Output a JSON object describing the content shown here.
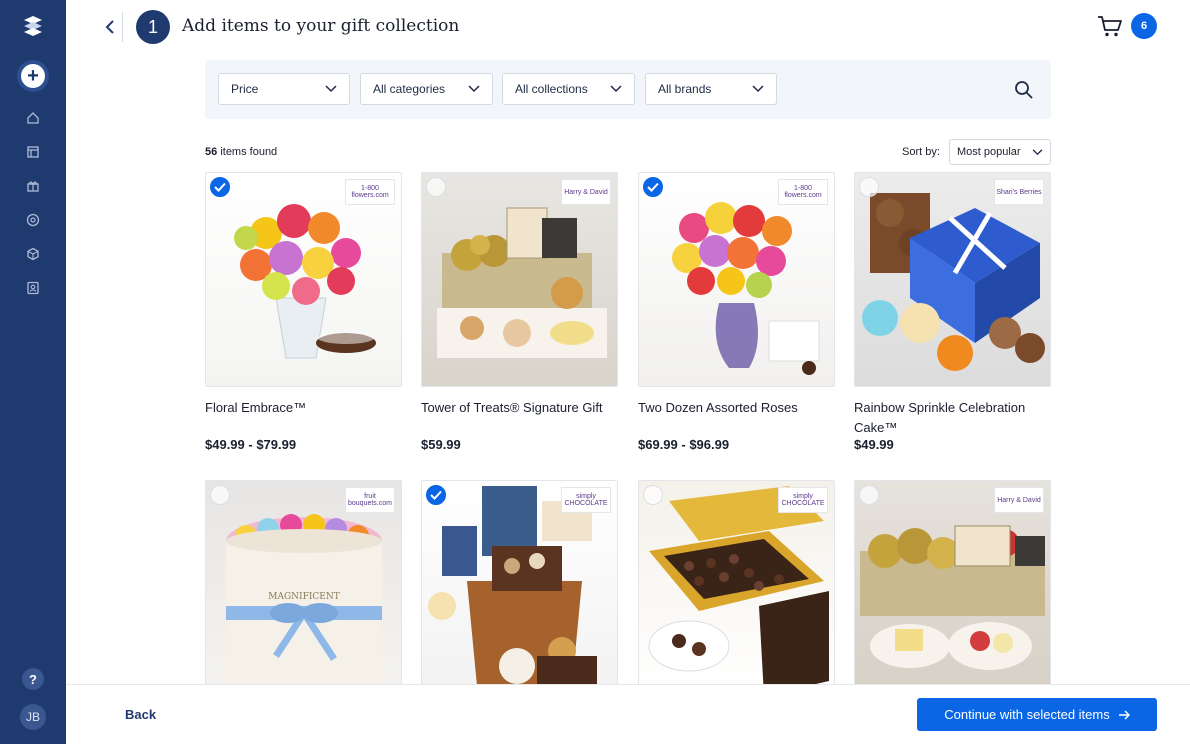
{
  "header": {
    "step_number": "1",
    "title": "Add items to your gift collection",
    "cart_count": "6"
  },
  "sidebar": {
    "avatar_initials": "JB",
    "help_label": "?"
  },
  "filters": {
    "price_label": "Price",
    "categories_label": "All categories",
    "collections_label": "All collections",
    "brands_label": "All brands"
  },
  "results": {
    "count": "56",
    "count_suffix": "items found",
    "sort_label": "Sort by:",
    "sort_value": "Most popular"
  },
  "products": [
    {
      "name": "Floral Embrace™",
      "price": "$49.99 - $79.99",
      "selected": true,
      "brand": "1-800 flowers.com"
    },
    {
      "name": "Tower of Treats® Signature Gift",
      "price": "$59.99",
      "selected": false,
      "brand": "Harry & David"
    },
    {
      "name": "Two Dozen Assorted Roses",
      "price": "$69.99 - $96.99",
      "selected": true,
      "brand": "1-800 flowers.com"
    },
    {
      "name": "Rainbow Sprinkle Celebration Cake™",
      "price": "$49.99",
      "selected": false,
      "brand": "Shari's Berries"
    },
    {
      "name": "",
      "price": "",
      "selected": false,
      "brand": "fruit bouquets.com"
    },
    {
      "name": "",
      "price": "",
      "selected": true,
      "brand": "simply CHOCOLATE"
    },
    {
      "name": "",
      "price": "",
      "selected": false,
      "brand": "simply CHOCOLATE"
    },
    {
      "name": "",
      "price": "",
      "selected": false,
      "brand": "Harry & David"
    }
  ],
  "footer": {
    "back_label": "Back",
    "continue_label": "Continue with selected items"
  },
  "colors": {
    "sidebar": "#1f3a6e",
    "accent": "#0a66e4",
    "filter_bg": "#f2f5fa"
  }
}
